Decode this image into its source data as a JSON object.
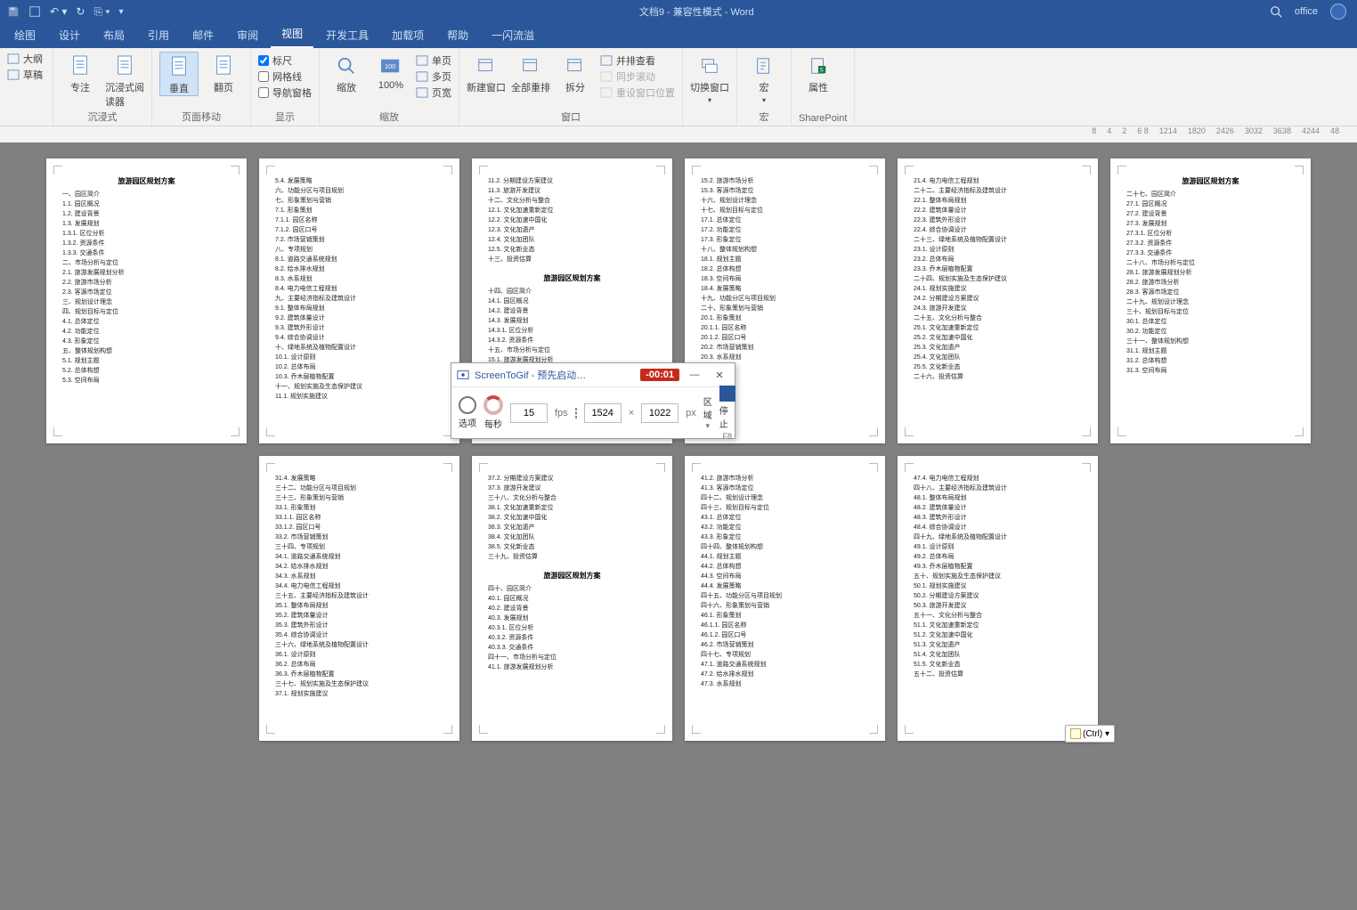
{
  "window": {
    "title": "文档9 - 兼容性模式 - Word",
    "user_label": "office"
  },
  "tabs": [
    "绘图",
    "设计",
    "布局",
    "引用",
    "邮件",
    "审阅",
    "视图",
    "开发工具",
    "加载项",
    "帮助",
    "一闪流溢"
  ],
  "active_tab": "视图",
  "ribbon": {
    "g0_items": [
      "大纲",
      "草稿"
    ],
    "g1": {
      "items": [
        "专注",
        "沉浸式阅读器"
      ],
      "label": "沉浸式"
    },
    "g2": {
      "items": [
        "垂直",
        "翻页"
      ],
      "label": "页面移动",
      "active": "垂直"
    },
    "g3": {
      "checks": [
        [
          "标尺",
          true
        ],
        [
          "网格线",
          false
        ],
        [
          "导航窗格",
          false
        ]
      ],
      "label": "显示"
    },
    "g4": {
      "items": [
        "缩放",
        "100%"
      ],
      "side": [
        "单页",
        "多页",
        "页宽"
      ],
      "label": "缩放"
    },
    "g5": {
      "items": [
        "新建窗口",
        "全部重排",
        "拆分"
      ],
      "side": [
        "并排查看",
        "同步滚动",
        "重设窗口位置"
      ],
      "label": "窗口"
    },
    "g6": {
      "item": "切换窗口",
      "label": ""
    },
    "g7": {
      "item": "宏",
      "label": "宏"
    },
    "g8": {
      "item": "属性",
      "label": "SharePoint"
    }
  },
  "ruler_ticks": [
    "8",
    "4",
    "2",
    "6 8",
    "1214",
    "1820",
    "2426",
    "3032",
    "3638",
    "4244",
    "48"
  ],
  "doc_title": "旅游园区规划方案",
  "pages": [
    {
      "title": true,
      "lines": [
        "一、园区简介",
        "1.1. 园区概况",
        "1.2. 建设背景",
        "1.3. 发展规划",
        "1.3.1. 区位分析",
        "1.3.2. 资源条件",
        "1.3.3. 交通条件",
        "二、市场分析与定位",
        "2.1. 旅游发展规划分析",
        "2.2. 旅游市场分析",
        "2.3. 客源市场定位",
        "三、规划设计理念",
        "四、规划目标与定位",
        "4.1. 总体定位",
        "4.2. 功能定位",
        "4.3. 形象定位",
        "五、整体规划构想",
        "5.1. 规划主题",
        "5.2. 总体构想",
        "5.3. 空间布局"
      ]
    },
    {
      "lines": [
        "5.4. 发展策略",
        "六、功能分区与项目规划",
        "七、形象策划与营销",
        "7.1. 形象策划",
        "7.1.1. 园区名称",
        "7.1.2. 园区口号",
        "7.2. 市场营销策划",
        "八、专项规划",
        "8.1. 道路交通系统规划",
        "8.2. 给水排水规划",
        "8.3. 水系规划",
        "8.4. 电力电信工程规划",
        "九、主要经济指标及建筑设计",
        "9.1. 整体布局规划",
        "9.2. 建筑体量设计",
        "9.3. 建筑外形设计",
        "9.4. 综合协调设计",
        "十、绿地系统及植物配置设计",
        "10.1. 设计原则",
        "10.2. 总体布局",
        "10.3. 乔木层植物配置",
        "十一、规划实施及生态保护建议",
        "11.1. 规划实施建议"
      ]
    },
    {
      "lines": [
        "11.2. 分期建设方案建议",
        "11.3. 旅游开发建议",
        "十二、文化分析与整合",
        "12.1. 文化加速重新定位",
        "12.2. 文化加速中国化",
        "12.3. 文化加遗产",
        "12.4. 文化加团队",
        "12.5. 文化新业态",
        "十三、投资估算"
      ],
      "title2": true,
      "lines2": [
        "十四、园区简介",
        "14.1. 园区概况",
        "14.2. 建设背景",
        "14.3. 发展规划",
        "14.3.1. 区位分析",
        "14.3.2. 资源条件",
        "十五、市场分析与定位",
        "15.1. 旅游发展规划分析"
      ]
    },
    {
      "lines": [
        "15.2. 旅游市场分析",
        "15.3. 客源市场定位",
        "十六、规划设计理念",
        "十七、规划目标与定位",
        "17.1. 总体定位",
        "17.2. 功能定位",
        "17.3. 形象定位",
        "十八、整体规划构想",
        "18.1. 规划主题",
        "18.2. 总体构想",
        "18.3. 空间布局",
        "18.4. 发展策略",
        "十九、功能分区与项目规划",
        "二十、形象策划与营销",
        "20.1. 形象策划",
        "20.1.1. 园区名称",
        "20.1.2. 园区口号",
        "20.2. 市场营销策划",
        "20.3. 水系规划"
      ]
    },
    {
      "lines": [
        "21.4. 电力电信工程规划",
        "二十二、主要经济指标及建筑设计",
        "22.1. 整体布局规划",
        "22.2. 建筑体量设计",
        "22.3. 建筑外形设计",
        "22.4. 综合协调设计",
        "二十三、绿地系统及植物配置设计",
        "23.1. 设计原则",
        "23.2. 总体布局",
        "23.3. 乔木层植物配置",
        "二十四、规划实施及生态保护建议",
        "24.1. 规划实施建议",
        "24.2. 分期建设方案建议",
        "24.3. 旅游开发建议",
        "二十五、文化分析与整合",
        "25.1. 文化加速重新定位",
        "25.2. 文化加速中国化",
        "25.3. 文化加遗产",
        "25.4. 文化加团队",
        "25.5. 文化新业态",
        "二十六、投资估算"
      ]
    },
    {
      "title": true,
      "lines": [
        "二十七、园区简介",
        "27.1. 园区概况",
        "27.2. 建设背景",
        "27.3. 发展规划",
        "27.3.1. 区位分析",
        "27.3.2. 资源条件",
        "27.3.3. 交通条件",
        "二十八、市场分析与定位",
        "28.1. 旅游发展规划分析",
        "28.2. 旅游市场分析",
        "28.3. 客源市场定位",
        "二十九、规划设计理念",
        "三十、规划目标与定位",
        "30.1. 总体定位",
        "30.2. 功能定位",
        "三十一、整体规划构想",
        "31.1. 规划主题",
        "31.2. 总体构想",
        "31.3. 空间布局"
      ]
    },
    {
      "lines": [
        "31.4. 发展策略",
        "三十二、功能分区与项目规划",
        "三十三、形象策划与营销",
        "33.1. 形象策划",
        "33.1.1. 园区名称",
        "33.1.2. 园区口号",
        "33.2. 市场营销策划",
        "三十四、专项规划",
        "34.1. 道路交通系统规划",
        "34.2. 给水排水规划",
        "34.3. 水系规划",
        "34.4. 电力电信工程规划",
        "三十五、主要经济指标及建筑设计",
        "35.1. 整体布局规划",
        "35.2. 建筑体量设计",
        "35.3. 建筑外形设计",
        "35.4. 综合协调设计",
        "三十六、绿地系统及植物配置设计",
        "36.1. 设计原则",
        "36.2. 总体布局",
        "36.3. 乔木层植物配置",
        "三十七、规划实施及生态保护建议",
        "37.1. 规划实施建议"
      ]
    },
    {
      "lines": [
        "37.2. 分期建设方案建议",
        "37.3. 旅游开发建议",
        "三十八、文化分析与整合",
        "38.1. 文化加速重新定位",
        "38.2. 文化加速中国化",
        "38.3. 文化加遗产",
        "38.4. 文化加团队",
        "38.5. 文化新业态",
        "三十九、投资估算"
      ],
      "title2": true,
      "lines2": [
        "四十、园区简介",
        "40.1. 园区概况",
        "40.2. 建设背景",
        "40.3. 发展规划",
        "40.3.1. 区位分析",
        "40.3.2. 资源条件",
        "40.3.3. 交通条件",
        "四十一、市场分析与定位",
        "41.1. 旅游发展规划分析"
      ]
    },
    {
      "lines": [
        "41.2. 旅游市场分析",
        "41.3. 客源市场定位",
        "四十二、规划设计理念",
        "四十三、规划目标与定位",
        "43.1. 总体定位",
        "43.2. 功能定位",
        "43.3. 形象定位",
        "四十四、整体规划构想",
        "44.1. 规划主题",
        "44.2. 总体构想",
        "44.3. 空间布局",
        "44.4. 发展策略",
        "四十五、功能分区与项目规划",
        "四十六、形象策划与营销",
        "46.1. 形象策划",
        "46.1.1. 园区名称",
        "46.1.2. 园区口号",
        "46.2. 市场营销策划",
        "四十七、专项规划",
        "47.1. 道路交通系统规划",
        "47.2. 给水排水规划",
        "47.3. 水系规划"
      ]
    },
    {
      "lines": [
        "47.4. 电力电信工程规划",
        "四十八、主要经济指标及建筑设计",
        "48.1. 整体布局规划",
        "48.2. 建筑体量设计",
        "48.3. 建筑外形设计",
        "48.4. 综合协调设计",
        "四十九、绿地系统及植物配置设计",
        "49.1. 设计原则",
        "49.2. 总体布局",
        "49.3. 乔木层植物配置",
        "五十、规划实施及生态保护建议",
        "50.1. 规划实施建议",
        "50.2. 分期建设方案建议",
        "50.3. 旅游开发建议",
        "五十一、文化分析与整合",
        "51.1. 文化加速重新定位",
        "51.2. 文化加速中国化",
        "51.3. 文化加遗产",
        "51.4. 文化加团队",
        "51.5. 文化新业态",
        "五十二、投资估算"
      ]
    }
  ],
  "paste_options": "(Ctrl) ▾",
  "dialog": {
    "title": "ScreenToGif - 预先启动…",
    "timer": "-00:01",
    "options": "选项",
    "fps": "15",
    "fps_unit": "fps",
    "per_sec": "每秒",
    "width": "1524",
    "height": "1022",
    "px": "px",
    "region": "区域",
    "stop": "停止",
    "stop_key": "F8"
  }
}
